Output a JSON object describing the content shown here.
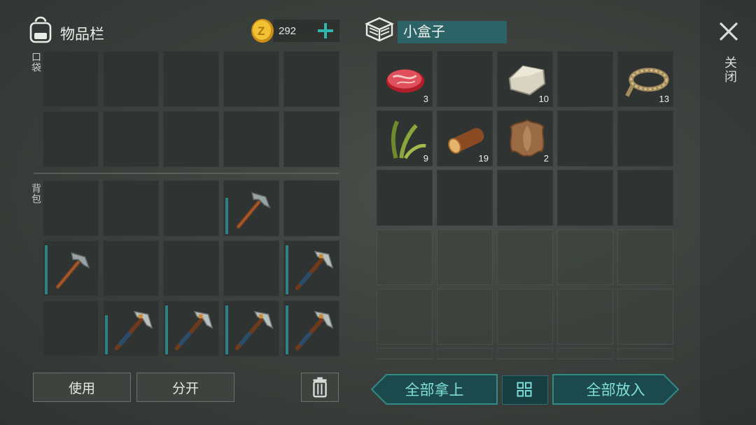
{
  "inventory": {
    "title": "物品栏",
    "coins": "292",
    "pockets_label": "口袋",
    "backpack_label": "背包",
    "backpack_slots": [
      {
        "item": "",
        "durability": 0
      },
      {
        "item": "",
        "durability": 0
      },
      {
        "item": "",
        "durability": 0
      },
      {
        "item": "stone-hammer",
        "durability": 0.7
      },
      {
        "item": "",
        "durability": 0
      },
      {
        "item": "stone-hammer",
        "durability": 0.95
      },
      {
        "item": "",
        "durability": 0
      },
      {
        "item": "",
        "durability": 0
      },
      {
        "item": "",
        "durability": 0
      },
      {
        "item": "iron-pickaxe",
        "durability": 0.95
      },
      {
        "item": "",
        "durability": 0
      },
      {
        "item": "iron-pickaxe",
        "durability": 0.75
      },
      {
        "item": "iron-pickaxe",
        "durability": 0.95
      },
      {
        "item": "iron-pickaxe",
        "durability": 0.95
      },
      {
        "item": "iron-pickaxe",
        "durability": 0.95
      }
    ],
    "use_label": "使用",
    "split_label": "分开"
  },
  "container": {
    "name": "小盒子",
    "items": [
      {
        "item": "raw-meat",
        "count": "3"
      },
      {
        "item": "",
        "count": ""
      },
      {
        "item": "stone",
        "count": "10"
      },
      {
        "item": "",
        "count": ""
      },
      {
        "item": "rope",
        "count": "13"
      },
      {
        "item": "plant-fiber",
        "count": "9"
      },
      {
        "item": "log",
        "count": "19"
      },
      {
        "item": "leather",
        "count": "2"
      },
      {
        "item": "",
        "count": ""
      },
      {
        "item": "",
        "count": ""
      }
    ],
    "take_all_label": "全部拿上",
    "put_all_label": "全部放入",
    "close_label": "关闭"
  },
  "colors": {
    "accent": "#2b6366",
    "button_teal": "#1c4a4c",
    "text_teal": "#7fe0dc",
    "coin_gold": "#e0a92a"
  },
  "icons": [
    "backpack-icon",
    "coin-icon",
    "plus-icon",
    "box-icon",
    "close-icon",
    "trash-icon",
    "sort-icon"
  ]
}
